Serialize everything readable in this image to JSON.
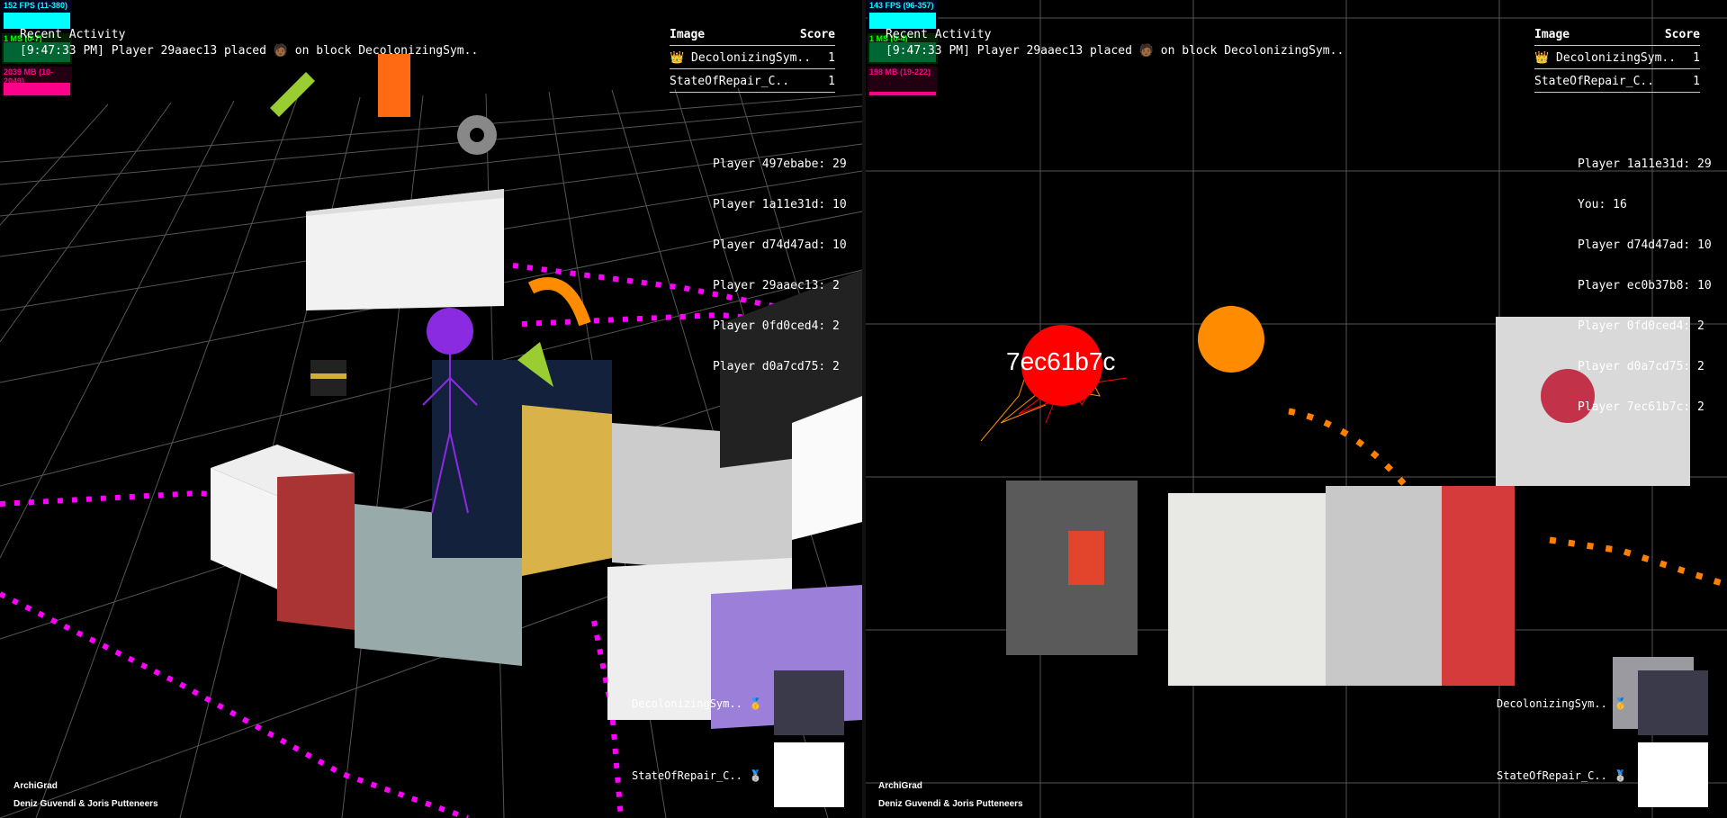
{
  "left_view": {
    "stats": {
      "fps": "152 FPS (11-380)",
      "ms": "1 MS (0-7)",
      "mb": "2039 MB (10-2049)"
    },
    "activity": {
      "title": "Recent Activity",
      "entry": "[9:47:33 PM] Player 29aaec13 placed 🧑🏾 on block DecolonizingSym.."
    },
    "scoreboard": {
      "col_image": "Image",
      "col_score": "Score",
      "rows": [
        {
          "name": "👑 DecolonizingSym..",
          "score": "1"
        },
        {
          "name": "StateOfRepair_C..",
          "score": "1"
        }
      ]
    },
    "players": [
      "Player 497ebabe: 29",
      "Player 1a11e31d: 10",
      "Player d74d47ad: 10",
      "Player 29aaec13: 2",
      "Player 0fd0ced4: 2",
      "Player d0a7cd75: 2"
    ],
    "labels": [
      "DecolonizingSym.. 🥇",
      "StateOfRepair_C.. 🥈"
    ],
    "credits": [
      "ArchiGrad",
      "Deniz Guvendi & Joris Putteneers"
    ]
  },
  "right_view": {
    "stats": {
      "fps": "143 FPS (96-357)",
      "ms": "1 MS (0-4)",
      "mb": "198 MB (19-222)"
    },
    "activity": {
      "title": "Recent Activity",
      "entry": "[9:47:33 PM] Player 29aaec13 placed 🧑🏾 on block DecolonizingSym.."
    },
    "scoreboard": {
      "col_image": "Image",
      "col_score": "Score",
      "rows": [
        {
          "name": "👑 DecolonizingSym..",
          "score": "1"
        },
        {
          "name": "StateOfRepair_C..",
          "score": "1"
        }
      ]
    },
    "players": [
      "Player 1a11e31d: 29",
      "You: 16",
      "Player d74d47ad: 10",
      "Player ec0b37b8: 10",
      "Player 0fd0ced4: 2",
      "Player d0a7cd75: 2",
      "Player 7ec61b7c: 2"
    ],
    "avatar_label": "7ec61b7c",
    "labels": [
      "DecolonizingSym.. 🥇",
      "StateOfRepair_C.. 🥈"
    ],
    "credits": [
      "ArchiGrad",
      "Deniz Guvendi & Joris Putteneers"
    ]
  },
  "colors": {
    "trail_magenta": "#ff00ff",
    "trail_orange": "#ff7f00",
    "avatar_red": "#ff0000",
    "avatar_orange": "#ff8c00",
    "avatar_purple": "#8a2be2",
    "fps": "#00ffff",
    "ms": "#00ff00",
    "mb": "#ff0088"
  }
}
